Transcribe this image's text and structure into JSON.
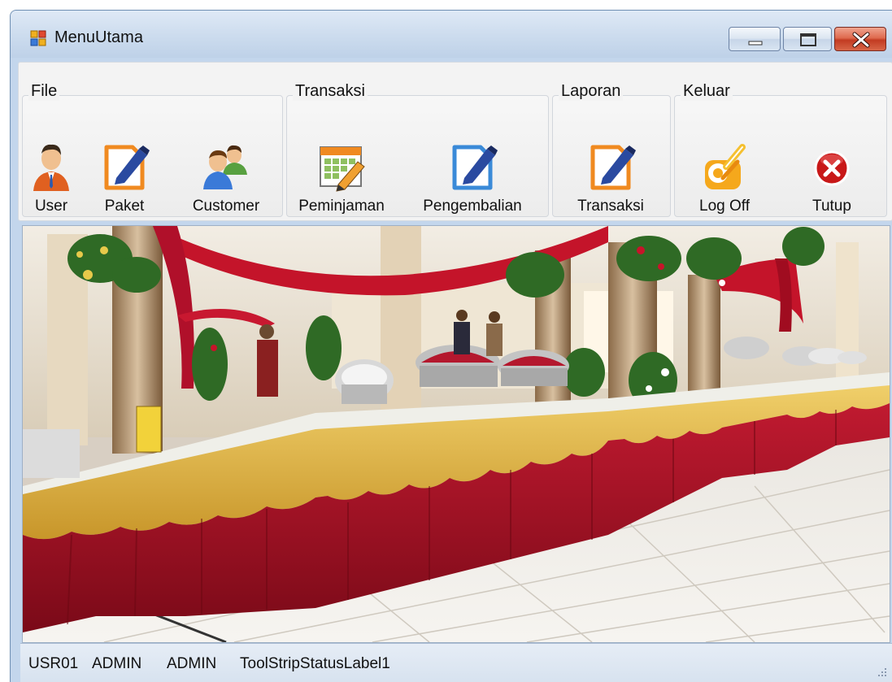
{
  "window": {
    "title": "MenuUtama"
  },
  "ribbon": {
    "groups": [
      {
        "label": "File",
        "buttons": [
          {
            "label": "User",
            "icon": "user-icon"
          },
          {
            "label": "Paket",
            "icon": "edit-icon"
          },
          {
            "label": "Customer",
            "icon": "users-icon"
          }
        ]
      },
      {
        "label": "Transaksi",
        "buttons": [
          {
            "label": "Peminjaman",
            "icon": "calendar-edit-icon"
          },
          {
            "label": "Pengembalian",
            "icon": "document-edit-icon"
          }
        ]
      },
      {
        "label": "Laporan",
        "buttons": [
          {
            "label": "Transaksi",
            "icon": "edit-icon"
          }
        ]
      },
      {
        "label": "Keluar",
        "buttons": [
          {
            "label": "Log Off",
            "icon": "key-lock-icon"
          },
          {
            "label": "Tutup",
            "icon": "close-circle-icon"
          }
        ]
      }
    ]
  },
  "statusbar": {
    "items": [
      "USR01",
      "ADMIN",
      "ADMIN",
      "ToolStripStatusLabel1"
    ]
  },
  "colors": {
    "title_bar": "#cfdeef",
    "close_button": "#c23b22",
    "table_skirt": "#a8142a",
    "table_top": "#d9a73a"
  }
}
